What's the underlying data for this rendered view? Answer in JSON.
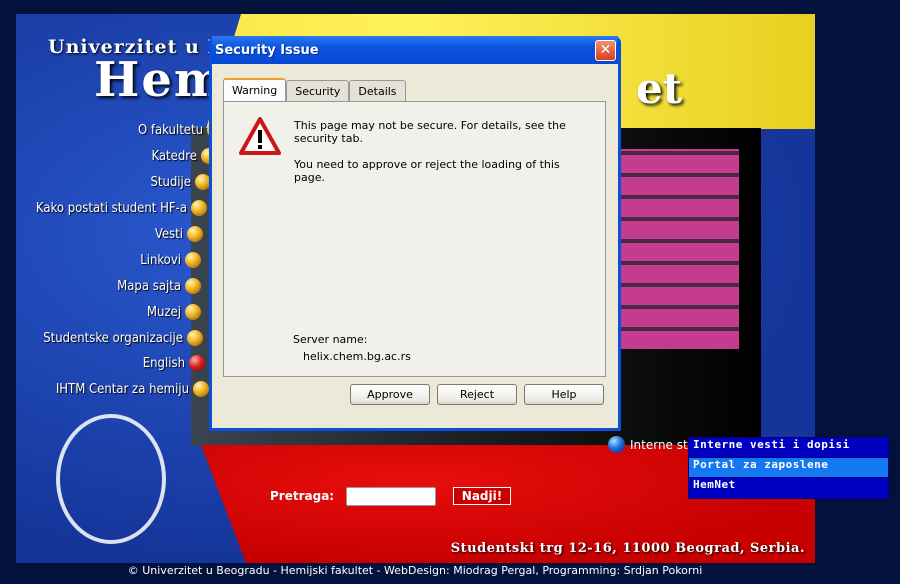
{
  "site": {
    "brand_line1": "Univerzitet u Beogradu",
    "brand_line2": "Hem",
    "brand_line2_end": "et",
    "nav": [
      "O fakultetu",
      "Katedre",
      "Studije",
      "Kako postati student HF-a",
      "Vesti",
      "Linkovi",
      "Mapa sajta",
      "Muzej",
      "Studentske organizacije",
      "English",
      "IHTM Centar za hemiju"
    ],
    "search_label": "Pretraga:",
    "search_value": "",
    "search_button": "Nadji!",
    "interne_label": "Interne str",
    "address": "Studentski trg 12-16, 11000 Beograd, Serbia.",
    "footer": "© Univerzitet u Beogradu - Hemijski fakultet - WebDesign: Miodrag Pergal, Programming: Srdjan Pokorni"
  },
  "dropdown": {
    "items": [
      "Interne vesti i dopisi",
      "Portal za zaposlene",
      "HemNet"
    ],
    "highlighted": 1
  },
  "dialog": {
    "title": "Security Issue",
    "tabs": [
      "Warning",
      "Security",
      "Details"
    ],
    "active_tab": "Warning",
    "message1": "This page may not be secure. For details, see the security tab.",
    "message2": "You need to approve or reject the loading of this page.",
    "server_label": "Server name:",
    "server_name": "helix.chem.bg.ac.rs",
    "buttons": {
      "approve": "Approve",
      "reject": "Reject",
      "help": "Help"
    },
    "icon": "warning-triangle-icon"
  },
  "colors": {
    "accent": "#0a50d8",
    "menu": "#0000c0",
    "menu_highlight": "#1478f0"
  }
}
